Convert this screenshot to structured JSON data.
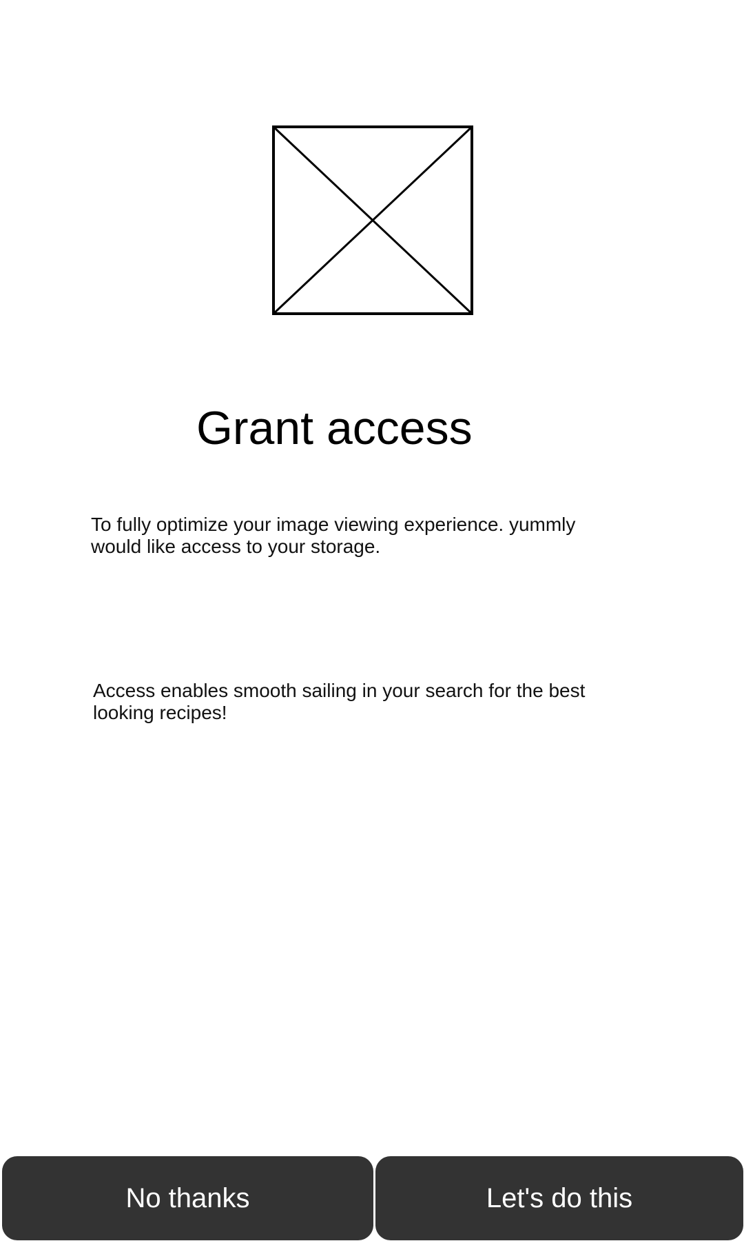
{
  "hero": {
    "image": "placeholder-image-icon"
  },
  "title": "Grant access",
  "description": "To fully optimize your image viewing experience. yummly would like access to your storage.",
  "secondary_description": "Access enables smooth sailing in your search for the best looking recipes!",
  "actions": {
    "decline_label": "No thanks",
    "accept_label": "Let's do this"
  },
  "colors": {
    "background": "#ffffff",
    "button_background": "#333333",
    "button_text": "#ffffff",
    "text": "#000000"
  }
}
